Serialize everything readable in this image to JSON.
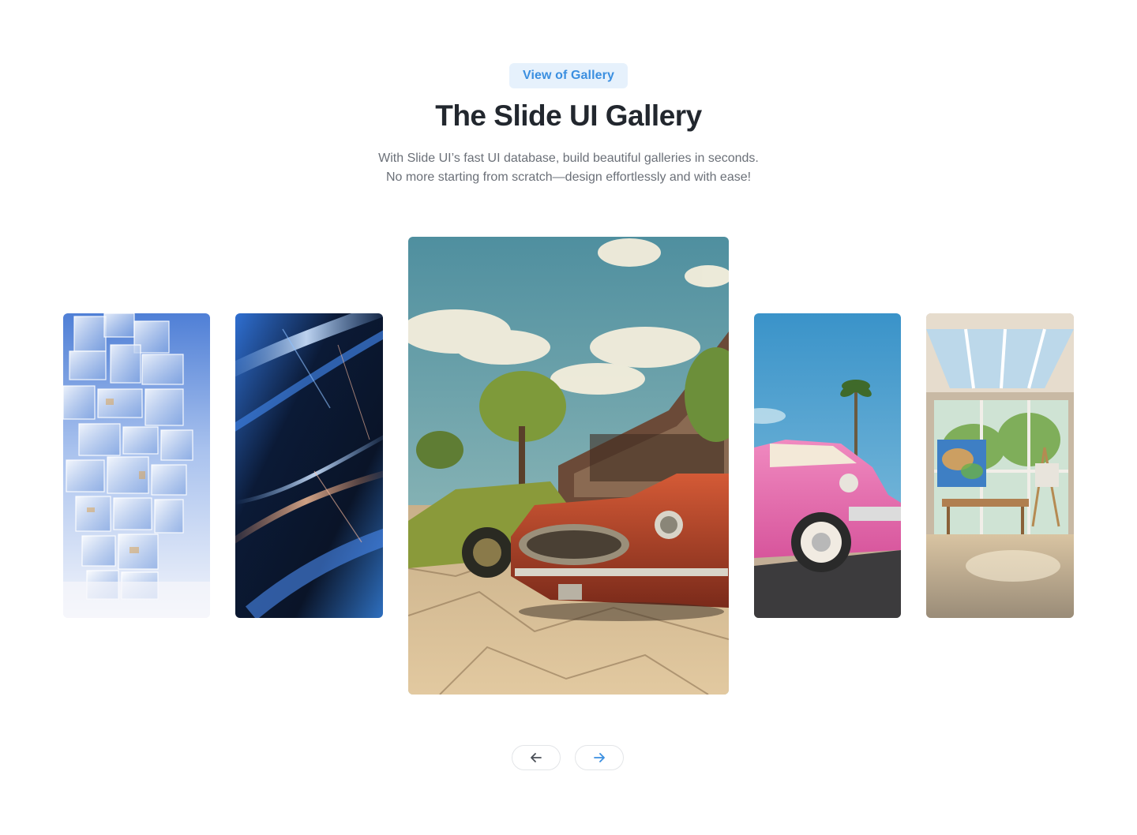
{
  "header": {
    "badge": "View of Gallery",
    "title": "The Slide UI Gallery",
    "subtitle_line1": "With Slide UI’s fast UI database, build beautiful galleries in seconds.",
    "subtitle_line2": "No more starting from scratch—design effortlessly and with ease!"
  },
  "gallery": {
    "slides": [
      {
        "subject": "glass-cubes-tower"
      },
      {
        "subject": "abstract-blue-streaks"
      },
      {
        "subject": "vintage-cars-street",
        "active": true
      },
      {
        "subject": "pink-classic-car-palm"
      },
      {
        "subject": "art-studio-interior"
      }
    ]
  },
  "navigation": {
    "prev_icon": "arrow-left-icon",
    "next_icon": "arrow-right-icon"
  },
  "colors": {
    "accent": "#3b8fe0",
    "badge_bg": "#e6f1fc",
    "title": "#22272e",
    "subtitle": "#6b7078"
  }
}
